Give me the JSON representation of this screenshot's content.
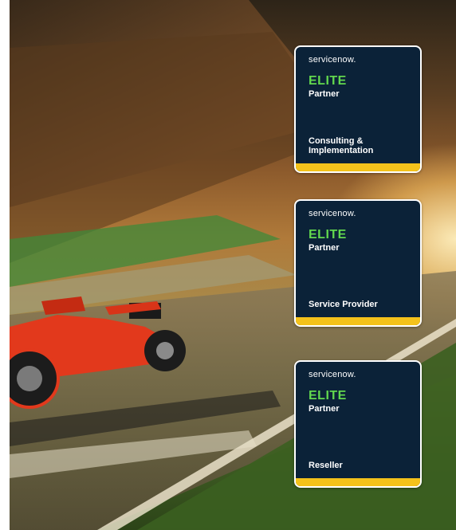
{
  "badges": [
    {
      "brand": "servicenow.",
      "tier": "ELITE",
      "level": "Partner",
      "category": "Consulting &\nImplementation"
    },
    {
      "brand": "servicenow.",
      "tier": "ELITE",
      "level": "Partner",
      "category": "Service Provider"
    },
    {
      "brand": "servicenow.",
      "tier": "ELITE",
      "level": "Partner",
      "category": "Reseller"
    }
  ],
  "colors": {
    "badge_background": "#0b2238",
    "elite_green": "#62d84e",
    "stripe_yellow": "#f4c21b",
    "border": "#ffffff"
  }
}
